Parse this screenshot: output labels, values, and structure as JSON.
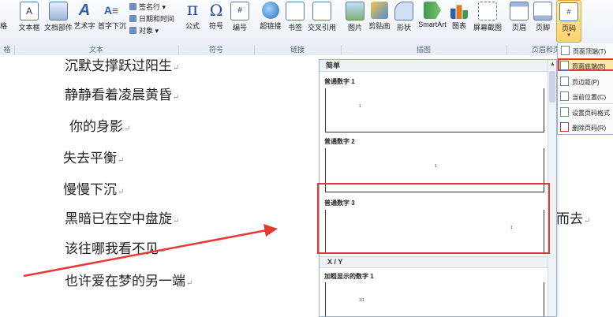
{
  "ribbon": {
    "left_cut": "格",
    "buttons": [
      {
        "label": "文本框",
        "name": "textbox-button"
      },
      {
        "label": "文档部件",
        "name": "quick-parts-button"
      },
      {
        "label": "艺术字",
        "name": "wordart-button"
      },
      {
        "label": "首字下沉",
        "name": "dropcap-button"
      },
      {
        "label": "公式",
        "name": "equation-button"
      },
      {
        "label": "符号",
        "name": "symbol-button"
      },
      {
        "label": "编号",
        "name": "number-button"
      },
      {
        "label": "超链接",
        "name": "hyperlink-button"
      },
      {
        "label": "书签",
        "name": "bookmark-button"
      },
      {
        "label": "交叉引用",
        "name": "cross-reference-button"
      },
      {
        "label": "图片",
        "name": "picture-button"
      },
      {
        "label": "剪贴画",
        "name": "clipart-button"
      },
      {
        "label": "形状",
        "name": "shapes-button"
      },
      {
        "label": "SmartArt",
        "name": "smartart-button"
      },
      {
        "label": "图表",
        "name": "chart-button"
      },
      {
        "label": "屏幕截图",
        "name": "screenshot-button"
      },
      {
        "label": "页眉",
        "name": "header-button"
      },
      {
        "label": "页脚",
        "name": "footer-button"
      },
      {
        "label": "页码",
        "name": "page-number-button"
      }
    ],
    "small": {
      "signature": "签名行 ▾",
      "datetime": "日期和时间",
      "object": "对象 ▾"
    },
    "groups": {
      "cut": "格",
      "text": "文本",
      "symbols": "符号",
      "links": "链接",
      "illustrations": "插图",
      "header_footer": "页眉和页"
    }
  },
  "document": {
    "lines": [
      "沉默支撑跃过阳生",
      "静静看着凌晨黄昏",
      "你的身影",
      "失去平衡",
      "慢慢下沉",
      "黑暗已在空中盘旋",
      "该往哪我看不见",
      "也许爱在梦的另一端"
    ],
    "line_tail": "而去",
    "para_mark": "↵"
  },
  "gallery": {
    "header": "简单",
    "items": [
      {
        "title": "普通数字 1",
        "num": "1"
      },
      {
        "title": "普通数字 2",
        "num": "1"
      },
      {
        "title": "普通数字 3",
        "num": "1"
      }
    ],
    "section2": "X / Y",
    "item4_title": "加粗显示的数字 1",
    "item4_num": "1/1"
  },
  "menu": {
    "items": [
      "页面顶端(T)",
      "页面底端(B)",
      "页边距(P)",
      "当前位置(C)",
      "设置页码格式",
      "删除页码(R)"
    ]
  },
  "colors": {
    "highlight": "#e53935",
    "arrow": "#e53935"
  }
}
